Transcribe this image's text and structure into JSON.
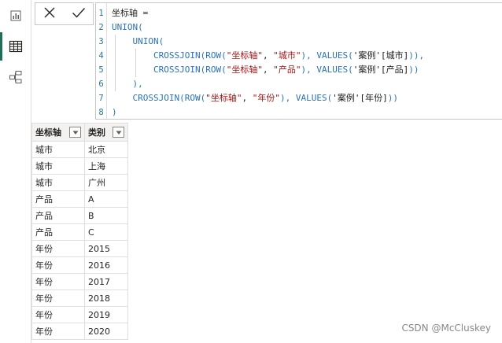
{
  "rail": {
    "items": [
      {
        "icon": "report-view-icon"
      },
      {
        "icon": "data-view-icon",
        "active": true
      },
      {
        "icon": "model-view-icon"
      }
    ]
  },
  "formula_bar": {
    "cancel_icon": "close-icon",
    "commit_icon": "checkmark-icon",
    "line_numbers": [
      "1",
      "2",
      "3",
      "4",
      "5",
      "6",
      "7",
      "8"
    ],
    "lines": [
      [
        {
          "t": "坐标轴 =",
          "c": "plain"
        }
      ],
      [
        {
          "t": "UNION",
          "c": "fn"
        },
        {
          "t": "(",
          "c": "p"
        }
      ],
      [
        {
          "t": "    UNION",
          "c": "fn"
        },
        {
          "t": "(",
          "c": "p"
        }
      ],
      [
        {
          "t": "        CROSSJOIN",
          "c": "fn"
        },
        {
          "t": "(",
          "c": "p"
        },
        {
          "t": "ROW",
          "c": "fn"
        },
        {
          "t": "(",
          "c": "p"
        },
        {
          "t": "\"坐标轴\"",
          "c": "str"
        },
        {
          "t": ", ",
          "c": "plain"
        },
        {
          "t": "\"城市\"",
          "c": "str"
        },
        {
          "t": "), ",
          "c": "p"
        },
        {
          "t": "VALUES",
          "c": "fn"
        },
        {
          "t": "(",
          "c": "p"
        },
        {
          "t": "'案例'[城市]",
          "c": "ref"
        },
        {
          "t": ")),",
          "c": "p"
        }
      ],
      [
        {
          "t": "        CROSSJOIN",
          "c": "fn"
        },
        {
          "t": "(",
          "c": "p"
        },
        {
          "t": "ROW",
          "c": "fn"
        },
        {
          "t": "(",
          "c": "p"
        },
        {
          "t": "\"坐标轴\"",
          "c": "str"
        },
        {
          "t": ", ",
          "c": "plain"
        },
        {
          "t": "\"产品\"",
          "c": "str"
        },
        {
          "t": "), ",
          "c": "p"
        },
        {
          "t": "VALUES",
          "c": "fn"
        },
        {
          "t": "(",
          "c": "p"
        },
        {
          "t": "'案例'[产品]",
          "c": "ref"
        },
        {
          "t": "))",
          "c": "p"
        }
      ],
      [
        {
          "t": "    ),",
          "c": "p"
        }
      ],
      [
        {
          "t": "    CROSSJOIN",
          "c": "fn"
        },
        {
          "t": "(",
          "c": "p"
        },
        {
          "t": "ROW",
          "c": "fn"
        },
        {
          "t": "(",
          "c": "p"
        },
        {
          "t": "\"坐标轴\"",
          "c": "str"
        },
        {
          "t": ", ",
          "c": "plain"
        },
        {
          "t": "\"年份\"",
          "c": "str"
        },
        {
          "t": "), ",
          "c": "p"
        },
        {
          "t": "VALUES",
          "c": "fn"
        },
        {
          "t": "(",
          "c": "p"
        },
        {
          "t": "'案例'[年份]",
          "c": "ref"
        },
        {
          "t": "))",
          "c": "p"
        }
      ],
      [
        {
          "t": ")",
          "c": "p"
        }
      ]
    ]
  },
  "table": {
    "columns": [
      "坐标轴",
      "类别"
    ],
    "filter_icon": "dropdown-filter-icon",
    "rows": [
      [
        "城市",
        "北京"
      ],
      [
        "城市",
        "上海"
      ],
      [
        "城市",
        "广州"
      ],
      [
        "产品",
        "A"
      ],
      [
        "产品",
        "B"
      ],
      [
        "产品",
        "C"
      ],
      [
        "年份",
        "2015"
      ],
      [
        "年份",
        "2016"
      ],
      [
        "年份",
        "2017"
      ],
      [
        "年份",
        "2018"
      ],
      [
        "年份",
        "2019"
      ],
      [
        "年份",
        "2020"
      ]
    ]
  },
  "watermark": "CSDN @McCluskey",
  "colors": {
    "accent": "#1e6e5a",
    "keyword": "#2b72b6",
    "string": "#a31515",
    "line_number": "#237893"
  }
}
